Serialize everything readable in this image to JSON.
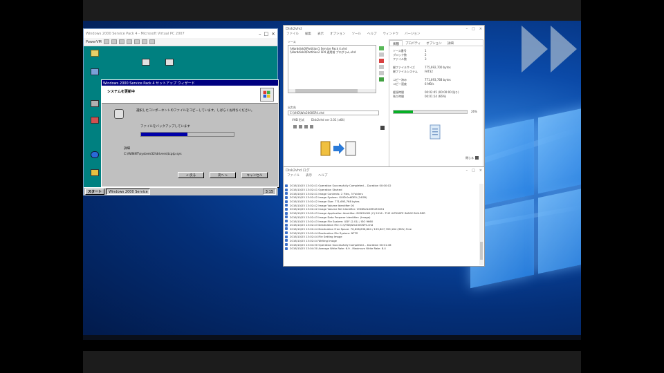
{
  "vm": {
    "title": "Windows 2000 Service Pack 4 - Microsoft Virtual PC 2007",
    "toolbar_label": "PowerVM",
    "desktop_icons": [
      "マイ ドキュメント",
      "マイ コンピュータ",
      "マイ ネットワーク",
      "ごみ箱",
      "Internet Explorer",
      "Outlook"
    ],
    "dialog_title": "Windows 2000 Service Pack 4 セットアップ ウィザード",
    "dialog_heading": "システムを更新中",
    "dialog_text": "選択したコンポーネントのファイルをコピーしています。しばらくお待ちください。",
    "progress_label": "ファイルをバックアップしています",
    "progress_fraction": 0.5,
    "detail_label": "詳細",
    "detail_text": "C:\\WINNT\\system32\\drivers\\tcpip.sys",
    "buttons": [
      "< 戻る",
      "次へ >",
      "キャンセル"
    ],
    "start_label": "スタート",
    "task_label": "Windows 2000 Service",
    "tray_time": "3:15"
  },
  "app": {
    "title": "Disk2vhd",
    "menu": [
      "ファイル",
      "編集",
      "表示",
      "オプション",
      "ツール",
      "ヘルプ",
      "ウィンドウ",
      "バージョン"
    ],
    "list_header": "ソース",
    "list_items": [
      "\\\\Harddisk0\\Partition1 Service Pack 4.vhd",
      "\\\\Harddisk0\\Partition2 SP4 適用前 プログラム.vhd"
    ],
    "dest_label": "出力先",
    "dest_value": "C:\\VHD\\Win2000SP4.vhd",
    "option_label": "VHD 形式",
    "option_value": "Disk2vhd ver 2.01 (x64)",
    "tabs": [
      "状態",
      "プロパティ",
      "オプション",
      "詳細"
    ],
    "stats": [
      {
        "k": "ソース番号",
        "v": "1"
      },
      {
        "k": "ブロック数",
        "v": "2"
      },
      {
        "k": "ファイル数",
        "v": "3"
      },
      {
        "k": "総ファイルサイズ",
        "v": "775,692,700 bytes"
      },
      {
        "k": "総ファイルシステム",
        "v": "FAT32"
      },
      {
        "k": "コピー済み",
        "v": "771,693,768 bytes"
      },
      {
        "k": "コピー速度",
        "v": "6 MB/s"
      },
      {
        "k": "経過時間",
        "v": "00:02:45 (00:00:00 残り)"
      },
      {
        "k": "残り時間",
        "v": "00:01:14 (66%)"
      }
    ],
    "progress_fraction": 0.26,
    "progress_text": "26%",
    "close_label": "閉じる",
    "status": "Ready"
  },
  "log": {
    "title": "Disk2vhd ログ",
    "menu": [
      "ファイル",
      "表示",
      "ヘルプ"
    ],
    "lines": [
      "2016/10/25 13:02:41 Operation Successfully Completed. - Duration 00:00:02",
      "2016/10/25 13:02:41 Operation Started",
      "2016/10/25 13:02:41 Image Contents: 2 Files, 3 Folders",
      "2016/10/25 13:02:42 Image System: GUID:0x6DE0 (24GB)",
      "2016/10/25 13:02:42 Image Size: 771,693,768 bytes",
      "2016/10/25 13:02:42 Image Volume Identifier 00",
      "2016/10/25 13:02:42 Image Volume Set Identifier: VHDBUILDER4332E4",
      "2016/10/25 13:02:43 Image Application Identifier: DISK2VHD (C) 2016 - THE ULTIMATE IMAGE BUILDER",
      "2016/10/25 13:02:43 Image Data Preparer Identifier: (Image)",
      "2016/10/25 13:02:43 Image File System: UDF (2.01) / ISO 9660",
      "2016/10/25 13:02:43 Destination File: C:\\VHD\\Win2000SP4.vhd",
      "2016/10/25 13:02:44 Destination Free Space: 76,628,836,864 / 199,807,709,184 (38%) Free",
      "2016/10/25 13:02:44 Destination File System: NTFS",
      "2016/10/25 13:02:44 File Setting Image",
      "2016/10/25 13:02:44 Writing Image",
      "2016/10/25 13:04:30 Operation Successfully Completed. - Duration 00:01:46",
      "2016/10/25 13:04:30 Average Write Rate: 6.9 - Maximum Write Rate: 8.4"
    ]
  },
  "colors": {
    "vm_teal": "#008080",
    "dialog_title": "#000080",
    "progress_blue": "#0000a8",
    "progress_green": "#06b025",
    "desktop_blue": "#0b4aa8"
  }
}
